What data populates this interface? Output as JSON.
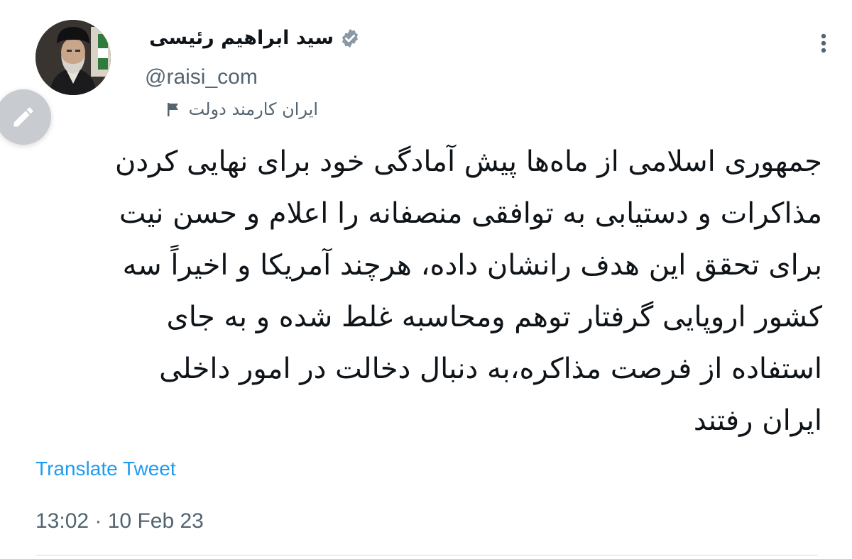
{
  "author": {
    "display_name": "سید ابراهیم رئیسی",
    "handle": "@raisi_com",
    "account_label": "ایران کارمند دولت",
    "verified_icon": "verified-badge-icon",
    "avatar_alt": "avatar"
  },
  "tweet": {
    "lines": [
      "جمهوری اسلامی از ماه‌ها پیش آمادگی خود برای نهایی کردن",
      "مذاکرات و دستیابی به توافقی منصفانه را اعلام و حسن نیت",
      "برای تحقق این هدف رانشان داده، هرچند آمریکا و اخیراً سه",
      "کشور اروپایی گرفتار توهم ومحاسبه غلط شده و به جای",
      "استفاده از فرصت مذاکره،به دنبال دخالت در امور داخلی",
      "ایران رفتند"
    ],
    "translate_label": "Translate Tweet",
    "timestamp": "13:02 · 10 Feb 23"
  },
  "actions": {
    "more_icon": "more-vertical-icon",
    "compose_icon": "pencil-icon"
  },
  "colors": {
    "link": "#1d9bf0",
    "secondary_text": "#536471",
    "primary_text": "#0f1419",
    "divider": "#cfd9de"
  }
}
